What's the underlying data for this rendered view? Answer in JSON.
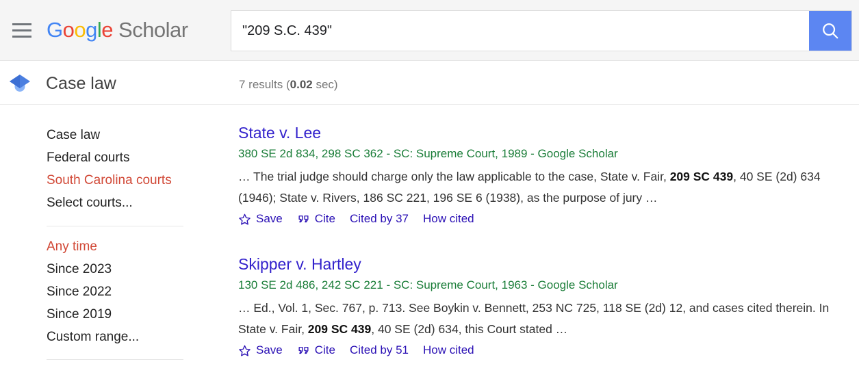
{
  "header": {
    "menu_icon": "hamburger-menu-icon",
    "logo": {
      "g1": "G",
      "o1": "o",
      "o2": "o",
      "g2": "g",
      "l1": "l",
      "e1": "e",
      "scholar": "Scholar"
    },
    "search": {
      "value": "\"209 S.C. 439\"",
      "placeholder": "",
      "button_icon": "search-icon",
      "button_color": "#5c86f2"
    }
  },
  "subheader": {
    "cap_icon": "graduation-cap-icon",
    "corpus_title": "Case law",
    "stats_prefix": "7 results (",
    "stats_time": "0.02",
    "stats_suffix": " sec)"
  },
  "sidebar": {
    "courts": [
      {
        "label": "Case law",
        "active": false
      },
      {
        "label": "Federal courts",
        "active": false
      },
      {
        "label": "South Carolina courts",
        "active": true
      },
      {
        "label": "Select courts...",
        "active": false
      }
    ],
    "dates": [
      {
        "label": "Any time",
        "active": true
      },
      {
        "label": "Since 2023",
        "active": false
      },
      {
        "label": "Since 2022",
        "active": false
      },
      {
        "label": "Since 2019",
        "active": false
      },
      {
        "label": "Custom range...",
        "active": false
      }
    ]
  },
  "results": [
    {
      "title": "State v. Lee",
      "citation": "380 SE 2d 834, 298 SC 362 - SC: Supreme Court, 1989 - Google Scholar",
      "snippet_pre": "… The trial judge should charge only the law applicable to the case, State v. Fair, ",
      "snippet_bold": "209 SC 439",
      "snippet_post": ", 40 SE (2d) 634 (1946); State v. Rivers, 186 SC 221, 196 SE 6 (1938), as the purpose of jury …",
      "actions": {
        "save": "Save",
        "cite": "Cite",
        "cited_by": "Cited by 37",
        "how_cited": "How cited"
      }
    },
    {
      "title": "Skipper v. Hartley",
      "citation": "130 SE 2d 486, 242 SC 221 - SC: Supreme Court, 1963 - Google Scholar",
      "snippet_pre": "… Ed., Vol. 1, Sec. 767, p. 713. See Boykin v. Bennett, 253 NC 725, 118 SE (2d) 12, and cases cited therein. In State v. Fair, ",
      "snippet_bold": "209 SC 439",
      "snippet_post": ", 40 SE (2d) 634, this Court stated …",
      "actions": {
        "save": "Save",
        "cite": "Cite",
        "cited_by": "Cited by 51",
        "how_cited": "How cited"
      }
    }
  ],
  "colors": {
    "link": "#3322cc",
    "action_link": "#2b11b5",
    "citation_green": "#1a7d38",
    "active_filter": "#d14836",
    "header_bg": "#f5f5f5"
  }
}
